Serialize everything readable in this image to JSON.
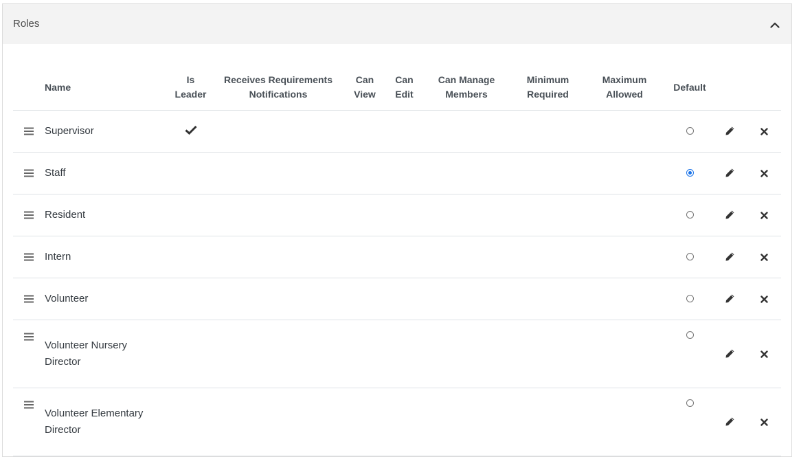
{
  "panel": {
    "title": "Roles",
    "collapse_icon": "chevron-up-icon"
  },
  "table": {
    "headers": {
      "name": "Name",
      "is_leader_1": "Is",
      "is_leader_2": "Leader",
      "receives_1": "Receives Requirements",
      "receives_2": "Notifications",
      "can_view_1": "Can",
      "can_view_2": "View",
      "can_edit_1": "Can",
      "can_edit_2": "Edit",
      "can_manage_1": "Can Manage",
      "can_manage_2": "Members",
      "minimum_1": "Minimum",
      "minimum_2": "Required",
      "maximum_1": "Maximum",
      "maximum_2": "Allowed",
      "default": "Default"
    },
    "rows": [
      {
        "name_1": "Supervisor",
        "name_2": "",
        "is_leader": true,
        "default": false
      },
      {
        "name_1": "Staff",
        "name_2": "",
        "is_leader": false,
        "default": true
      },
      {
        "name_1": "Resident",
        "name_2": "",
        "is_leader": false,
        "default": false
      },
      {
        "name_1": "Intern",
        "name_2": "",
        "is_leader": false,
        "default": false
      },
      {
        "name_1": "Volunteer",
        "name_2": "",
        "is_leader": false,
        "default": false
      },
      {
        "name_1": "Volunteer Nursery",
        "name_2": "Director",
        "is_leader": false,
        "default": false
      },
      {
        "name_1": "Volunteer Elementary",
        "name_2": "Director",
        "is_leader": false,
        "default": false
      }
    ],
    "row_icons": {
      "drag": "drag-handle-icon",
      "leader": "checkmark-icon",
      "edit": "pencil-icon",
      "delete": "close-icon"
    }
  },
  "colors": {
    "header_bg": "#f3f3f3",
    "border": "#dee2e6",
    "radio_checked": "#1a73e8"
  }
}
